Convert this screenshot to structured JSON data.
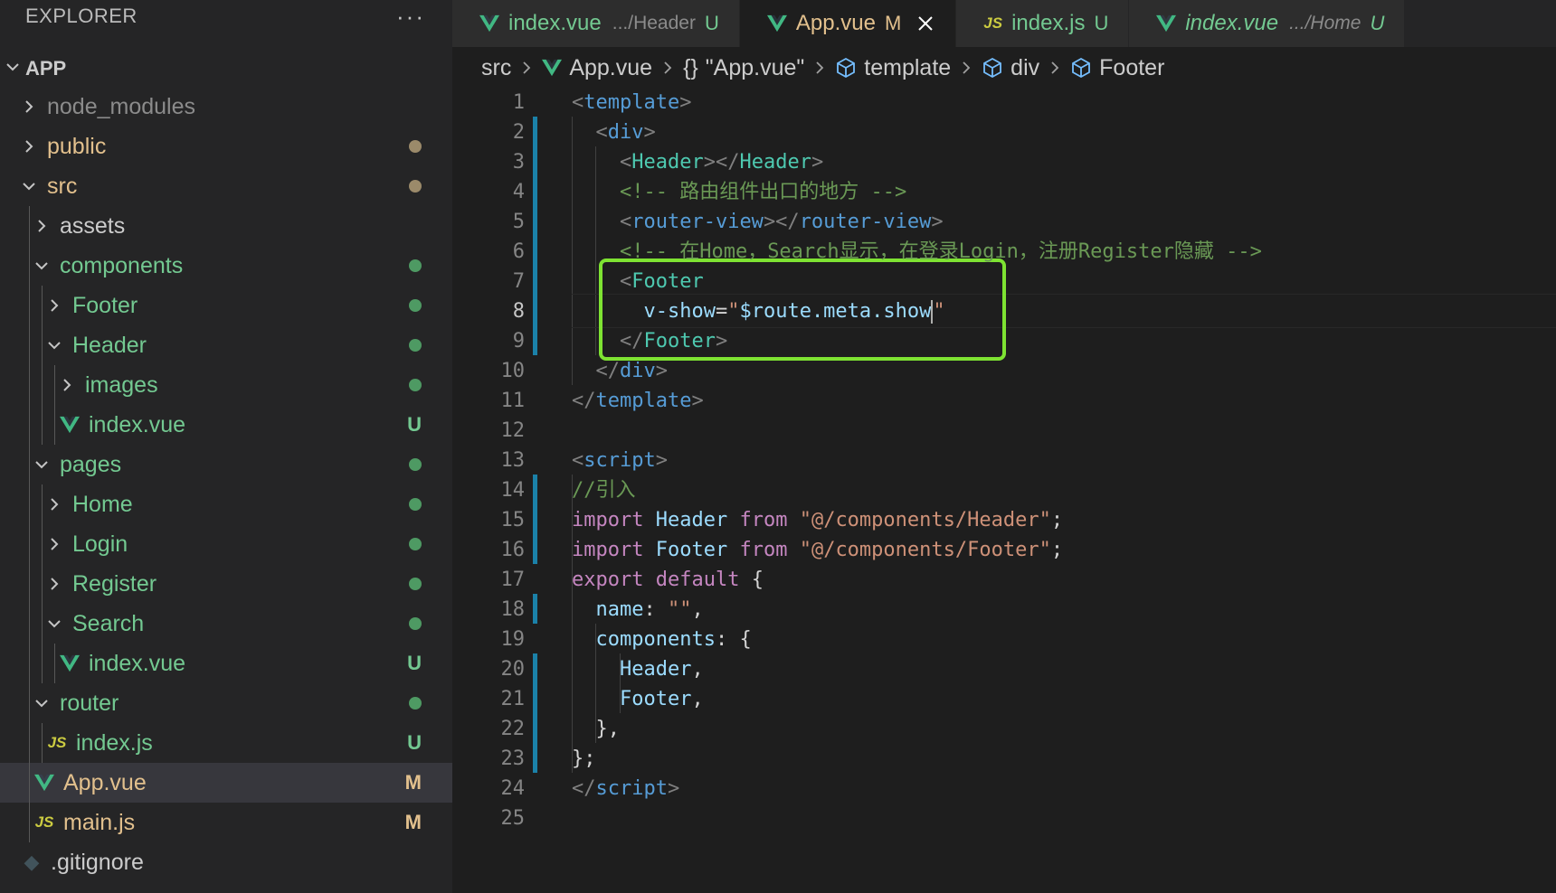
{
  "sidebar": {
    "title": "EXPLORER",
    "more": "···",
    "root": "APP",
    "items": [
      {
        "label": "node_modules",
        "depth": 0,
        "kind": "folder",
        "open": false,
        "color": "#8b8b8b",
        "status": ""
      },
      {
        "label": "public",
        "depth": 0,
        "kind": "folder",
        "open": false,
        "color": "#e2c08d",
        "status": "dot",
        "status_color": "#9b8a6a"
      },
      {
        "label": "src",
        "depth": 0,
        "kind": "folder",
        "open": true,
        "color": "#e2c08d",
        "status": "dot",
        "status_color": "#9b8a6a"
      },
      {
        "label": "assets",
        "depth": 1,
        "kind": "folder",
        "open": false,
        "color": "#cccccc",
        "status": ""
      },
      {
        "label": "components",
        "depth": 1,
        "kind": "folder",
        "open": true,
        "color": "#73c991",
        "status": "dot",
        "status_color": "#4e9a63"
      },
      {
        "label": "Footer",
        "depth": 2,
        "kind": "folder",
        "open": false,
        "color": "#73c991",
        "status": "dot",
        "status_color": "#4e9a63"
      },
      {
        "label": "Header",
        "depth": 2,
        "kind": "folder",
        "open": true,
        "color": "#73c991",
        "status": "dot",
        "status_color": "#4e9a63"
      },
      {
        "label": "images",
        "depth": 3,
        "kind": "folder",
        "open": false,
        "color": "#73c991",
        "status": "dot",
        "status_color": "#4e9a63"
      },
      {
        "label": "index.vue",
        "depth": 3,
        "kind": "vue",
        "color": "#73c991",
        "status": "U",
        "status_color": "#73c991"
      },
      {
        "label": "pages",
        "depth": 1,
        "kind": "folder",
        "open": true,
        "color": "#73c991",
        "status": "dot",
        "status_color": "#4e9a63"
      },
      {
        "label": "Home",
        "depth": 2,
        "kind": "folder",
        "open": false,
        "color": "#73c991",
        "status": "dot",
        "status_color": "#4e9a63"
      },
      {
        "label": "Login",
        "depth": 2,
        "kind": "folder",
        "open": false,
        "color": "#73c991",
        "status": "dot",
        "status_color": "#4e9a63"
      },
      {
        "label": "Register",
        "depth": 2,
        "kind": "folder",
        "open": false,
        "color": "#73c991",
        "status": "dot",
        "status_color": "#4e9a63"
      },
      {
        "label": "Search",
        "depth": 2,
        "kind": "folder",
        "open": true,
        "color": "#73c991",
        "status": "dot",
        "status_color": "#4e9a63"
      },
      {
        "label": "index.vue",
        "depth": 3,
        "kind": "vue",
        "color": "#73c991",
        "status": "U",
        "status_color": "#73c991"
      },
      {
        "label": "router",
        "depth": 1,
        "kind": "folder",
        "open": true,
        "color": "#73c991",
        "status": "dot",
        "status_color": "#4e9a63"
      },
      {
        "label": "index.js",
        "depth": 2,
        "kind": "js",
        "color": "#73c991",
        "status": "U",
        "status_color": "#73c991"
      },
      {
        "label": "App.vue",
        "depth": 1,
        "kind": "vue",
        "color": "#e2c08d",
        "status": "M",
        "status_color": "#e2c08d",
        "selected": true
      },
      {
        "label": "main.js",
        "depth": 1,
        "kind": "js",
        "color": "#e2c08d",
        "status": "M",
        "status_color": "#e2c08d"
      },
      {
        "label": ".gitignore",
        "depth": 0,
        "kind": "git",
        "color": "#cccccc",
        "status": ""
      }
    ]
  },
  "tabs": [
    {
      "name": "index.vue",
      "path": ".../Header",
      "status": "U",
      "kind": "vue",
      "color": "#73c991",
      "active": false,
      "italic": false
    },
    {
      "name": "App.vue",
      "path": "",
      "status": "M",
      "kind": "vue",
      "color": "#e2c08d",
      "active": true,
      "italic": false
    },
    {
      "name": "index.js",
      "path": "",
      "status": "U",
      "kind": "js",
      "color": "#73c991",
      "active": false,
      "italic": false
    },
    {
      "name": "index.vue",
      "path": ".../Home",
      "status": "U",
      "kind": "vue",
      "color": "#73c991",
      "active": false,
      "italic": true
    }
  ],
  "breadcrumb": [
    {
      "label": "src",
      "icon": ""
    },
    {
      "label": "App.vue",
      "icon": "vue-icon"
    },
    {
      "label": "\"App.vue\"",
      "icon": "braces-icon"
    },
    {
      "label": "template",
      "icon": "cube-icon"
    },
    {
      "label": "div",
      "icon": "cube-icon"
    },
    {
      "label": "Footer",
      "icon": "cube-icon"
    }
  ],
  "editor": {
    "current_line": 8,
    "highlight_lines": [
      7,
      9
    ],
    "lines": [
      [
        [
          "t-punc",
          "<"
        ],
        [
          "t-tag2",
          "template"
        ],
        [
          "t-punc",
          ">"
        ]
      ],
      [
        [
          "t-def",
          "  "
        ],
        [
          "t-punc",
          "<"
        ],
        [
          "t-tag2",
          "div"
        ],
        [
          "t-punc",
          ">"
        ]
      ],
      [
        [
          "t-def",
          "    "
        ],
        [
          "t-punc",
          "<"
        ],
        [
          "t-tag",
          "Header"
        ],
        [
          "t-punc",
          "></"
        ],
        [
          "t-tag",
          "Header"
        ],
        [
          "t-punc",
          ">"
        ]
      ],
      [
        [
          "t-def",
          "    "
        ],
        [
          "t-cmt",
          "<!-- 路由组件出口的地方 -->"
        ]
      ],
      [
        [
          "t-def",
          "    "
        ],
        [
          "t-punc",
          "<"
        ],
        [
          "t-tag2",
          "router-view"
        ],
        [
          "t-punc",
          "></"
        ],
        [
          "t-tag2",
          "router-view"
        ],
        [
          "t-punc",
          ">"
        ]
      ],
      [
        [
          "t-def",
          "    "
        ],
        [
          "t-cmt",
          "<!-- 在Home，Search显示，在登录Login，注册Register隐藏 -->"
        ]
      ],
      [
        [
          "t-def",
          "    "
        ],
        [
          "t-punc",
          "<"
        ],
        [
          "t-tag",
          "Footer"
        ]
      ],
      [
        [
          "t-def",
          "      "
        ],
        [
          "t-attr",
          "v-show"
        ],
        [
          "t-def",
          "="
        ],
        [
          "t-str",
          "\""
        ],
        [
          "t-id",
          "$route.meta.show"
        ],
        [
          "caret",
          ""
        ],
        [
          "t-str",
          "\""
        ]
      ],
      [
        [
          "t-def",
          "    "
        ],
        [
          "t-punc",
          "</"
        ],
        [
          "t-tag",
          "Footer"
        ],
        [
          "t-punc",
          ">"
        ]
      ],
      [
        [
          "t-def",
          "  "
        ],
        [
          "t-punc",
          "</"
        ],
        [
          "t-tag2",
          "div"
        ],
        [
          "t-punc",
          ">"
        ]
      ],
      [
        [
          "t-punc",
          "</"
        ],
        [
          "t-tag2",
          "template"
        ],
        [
          "t-punc",
          ">"
        ]
      ],
      [],
      [
        [
          "t-punc",
          "<"
        ],
        [
          "t-tag2",
          "script"
        ],
        [
          "t-punc",
          ">"
        ]
      ],
      [
        [
          "t-cmt",
          "//引入"
        ]
      ],
      [
        [
          "t-kw",
          "import"
        ],
        [
          "t-def",
          " "
        ],
        [
          "t-id",
          "Header"
        ],
        [
          "t-def",
          " "
        ],
        [
          "t-kw",
          "from"
        ],
        [
          "t-def",
          " "
        ],
        [
          "t-str",
          "\"@/components/Header\""
        ],
        [
          "t-def",
          ";"
        ]
      ],
      [
        [
          "t-kw",
          "import"
        ],
        [
          "t-def",
          " "
        ],
        [
          "t-id",
          "Footer"
        ],
        [
          "t-def",
          " "
        ],
        [
          "t-kw",
          "from"
        ],
        [
          "t-def",
          " "
        ],
        [
          "t-str",
          "\"@/components/Footer\""
        ],
        [
          "t-def",
          ";"
        ]
      ],
      [
        [
          "t-kw",
          "export"
        ],
        [
          "t-def",
          " "
        ],
        [
          "t-kw",
          "default"
        ],
        [
          "t-def",
          " {"
        ]
      ],
      [
        [
          "t-def",
          "  "
        ],
        [
          "t-id",
          "name"
        ],
        [
          "t-def",
          ": "
        ],
        [
          "t-str",
          "\"\""
        ],
        [
          "t-def",
          ","
        ]
      ],
      [
        [
          "t-def",
          "  "
        ],
        [
          "t-id",
          "components"
        ],
        [
          "t-def",
          ": {"
        ]
      ],
      [
        [
          "t-def",
          "    "
        ],
        [
          "t-id",
          "Header"
        ],
        [
          "t-def",
          ","
        ]
      ],
      [
        [
          "t-def",
          "    "
        ],
        [
          "t-id",
          "Footer"
        ],
        [
          "t-def",
          ","
        ]
      ],
      [
        [
          "t-def",
          "  },"
        ]
      ],
      [
        [
          "t-def",
          "};"
        ]
      ],
      [
        [
          "t-punc",
          "</"
        ],
        [
          "t-tag2",
          "script"
        ],
        [
          "t-punc",
          ">"
        ]
      ],
      []
    ],
    "gutter_marks": [
      [
        2,
        9
      ],
      [
        14,
        16
      ],
      [
        18,
        18
      ],
      [
        20,
        23
      ]
    ]
  }
}
